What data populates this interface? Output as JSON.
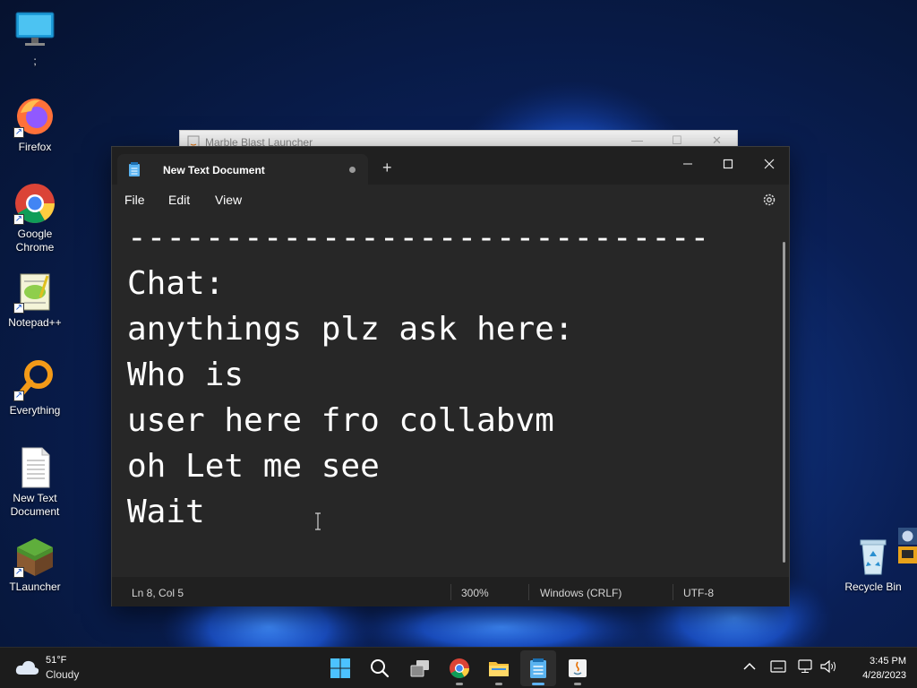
{
  "desktop": {
    "icons": [
      {
        "label": ";"
      },
      {
        "label": "Firefox"
      },
      {
        "label": "Google Chrome"
      },
      {
        "label": "Notepad++"
      },
      {
        "label": "Everything"
      },
      {
        "label": "New Text Document"
      },
      {
        "label": "TLauncher"
      }
    ],
    "recycle_bin": "Recycle Bin"
  },
  "background_window": {
    "title": "Marble Blast Launcher"
  },
  "notepad": {
    "tab_title": "New Text Document",
    "new_tab": "+",
    "menu": {
      "file": "File",
      "edit": "Edit",
      "view": "View"
    },
    "content_lines": [
      "------------------------------",
      "Chat:",
      "anythings plz ask here:",
      "Who is",
      "user here fro collabvm",
      "oh Let me see",
      "Wait"
    ],
    "status": {
      "position": "Ln 8, Col 5",
      "zoom": "300%",
      "line_ending": "Windows (CRLF)",
      "encoding": "UTF-8"
    }
  },
  "taskbar": {
    "weather": {
      "temp": "51°F",
      "condition": "Cloudy"
    },
    "apps": [
      "start-icon",
      "search-icon",
      "task-view-icon",
      "chrome-icon",
      "file-explorer-icon",
      "notepad-icon",
      "java-icon"
    ],
    "clock": {
      "time": "3:45 PM",
      "date": "4/28/2023"
    }
  },
  "colors": {
    "accent": "#5fb2f2",
    "notepad_bg": "#272727",
    "taskbar_bg": "#1c1c1c"
  }
}
